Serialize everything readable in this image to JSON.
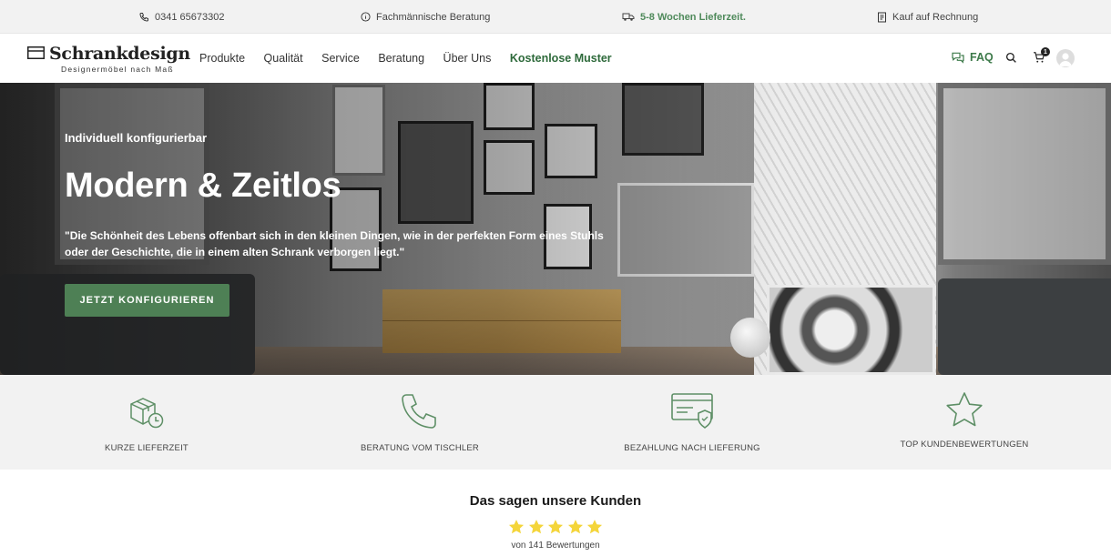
{
  "topbar": {
    "phone": "0341 65673302",
    "consult": "Fachmännische Beratung",
    "delivery": "5-8 Wochen Lieferzeit.",
    "invoice": "Kauf auf Rechnung"
  },
  "header": {
    "logo_name": "Schrankdesign",
    "logo_tagline": "Designermöbel nach Maß",
    "nav": [
      "Produkte",
      "Qualität",
      "Service",
      "Beratung",
      "Über Uns",
      "Kostenlose Muster"
    ],
    "faq_label": "FAQ",
    "cart_count": "1"
  },
  "hero": {
    "eyebrow": "Individuell konfigurierbar",
    "title": "Modern & Zeitlos",
    "quote": "\"Die Schönheit des Lebens offenbart sich in den kleinen Dingen, wie in der perfekten Form eines Stuhls oder der Geschichte, die in einem alten Schrank verborgen liegt.\"",
    "cta": "JETZT KONFIGURIEREN"
  },
  "features": [
    {
      "icon": "package-clock-icon",
      "label": "KURZE LIEFERZEIT"
    },
    {
      "icon": "phone-icon",
      "label": "BERATUNG VOM TISCHLER"
    },
    {
      "icon": "invoice-shield-icon",
      "label": "BEZAHLUNG NACH LIEFERUNG"
    },
    {
      "icon": "star-outline-icon",
      "label": "TOP KUNDENBEWERTUNGEN"
    }
  ],
  "reviews": {
    "title": "Das sagen unsere Kunden",
    "rating": 5,
    "count_text": "von 141 Bewertungen"
  },
  "colors": {
    "accent_green": "#4e8055",
    "nav_green": "#2e6a3b",
    "star_yellow": "#f4d53a",
    "feature_bg": "#f2f2f2"
  }
}
